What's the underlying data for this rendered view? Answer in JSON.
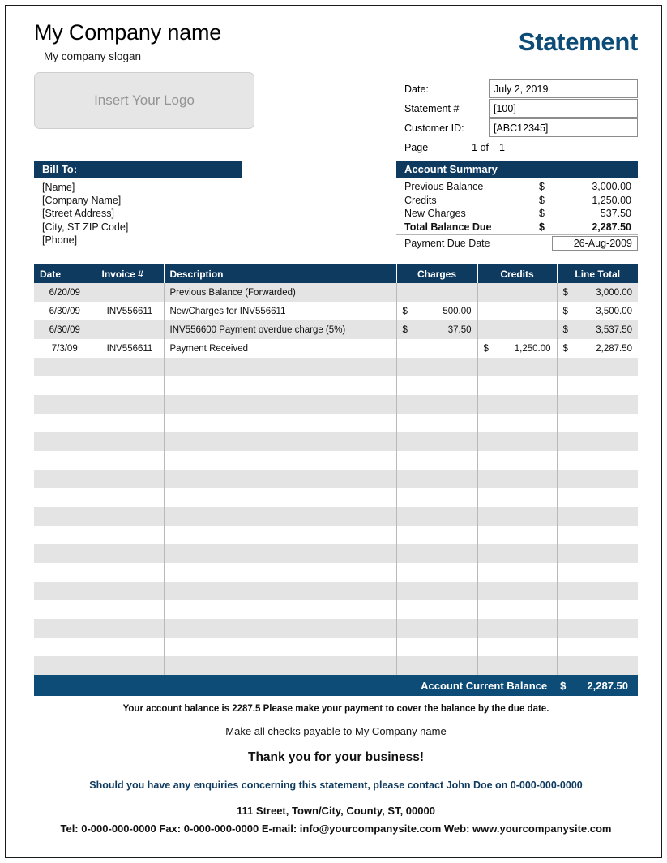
{
  "header": {
    "company_name": "My Company name",
    "company_slogan": "My company slogan",
    "logo_placeholder": "Insert Your Logo",
    "doc_title": "Statement"
  },
  "meta": {
    "date_label": "Date:",
    "date_value": "July 2, 2019",
    "statement_label": "Statement #",
    "statement_value": "[100]",
    "customer_label": "Customer ID:",
    "customer_value": "[ABC12345]",
    "page_label": "Page",
    "page_current": "1 of",
    "page_total": "1"
  },
  "bill_to": {
    "title": "Bill To:",
    "lines": [
      "[Name]",
      "[Company Name]",
      "[Street Address]",
      "[City, ST  ZIP Code]",
      "[Phone]"
    ]
  },
  "account_summary": {
    "title": "Account Summary",
    "currency": "$",
    "rows": [
      {
        "label": "Previous Balance",
        "amount": "3,000.00"
      },
      {
        "label": "Credits",
        "amount": "1,250.00"
      },
      {
        "label": "New Charges",
        "amount": "537.50"
      },
      {
        "label": "Total Balance Due",
        "amount": "2,287.50"
      }
    ],
    "due_label": "Payment Due Date",
    "due_date": "26-Aug-2009"
  },
  "table": {
    "columns": [
      "Date",
      "Invoice #",
      "Description",
      "Charges",
      "Credits",
      "Line Total"
    ],
    "rows": [
      {
        "date": "6/20/09",
        "invoice": "",
        "description": "Previous Balance (Forwarded)",
        "charges_cur": "",
        "charges": "",
        "credits_cur": "",
        "credits": "",
        "line_cur": "$",
        "line_total": "3,000.00"
      },
      {
        "date": "6/30/09",
        "invoice": "INV556611",
        "description": "NewCharges for INV556611",
        "charges_cur": "$",
        "charges": "500.00",
        "credits_cur": "",
        "credits": "",
        "line_cur": "$",
        "line_total": "3,500.00"
      },
      {
        "date": "6/30/09",
        "invoice": "",
        "description": "INV556600 Payment overdue charge (5%)",
        "charges_cur": "$",
        "charges": "37.50",
        "credits_cur": "",
        "credits": "",
        "line_cur": "$",
        "line_total": "3,537.50"
      },
      {
        "date": "7/3/09",
        "invoice": "INV556611",
        "description": "Payment Received",
        "charges_cur": "",
        "charges": "",
        "credits_cur": "$",
        "credits": "1,250.00",
        "line_cur": "$",
        "line_total": "2,287.50"
      }
    ],
    "empty_row_count": 17
  },
  "total_bar": {
    "label": "Account Current Balance",
    "currency": "$",
    "amount": "2,287.50"
  },
  "footer": {
    "balance_note": "Your account balance is 2287.5 Please make your payment to cover the balance by the due date.",
    "checks_note": "Make all checks payable to My Company name",
    "thanks": "Thank you for your business!",
    "enquiries": "Should you have any enquiries concerning this statement, please contact John Doe on 0-000-000-0000",
    "address": "111 Street, Town/City, County, ST, 00000",
    "contact": "Tel: 0-000-000-0000 Fax: 0-000-000-0000 E-mail: info@yourcompanysite.com Web: www.yourcompanysite.com"
  },
  "colors": {
    "navy": "#0e3a5f",
    "accent_blue": "#0e4c78",
    "stripe": "#e4e4e4"
  }
}
